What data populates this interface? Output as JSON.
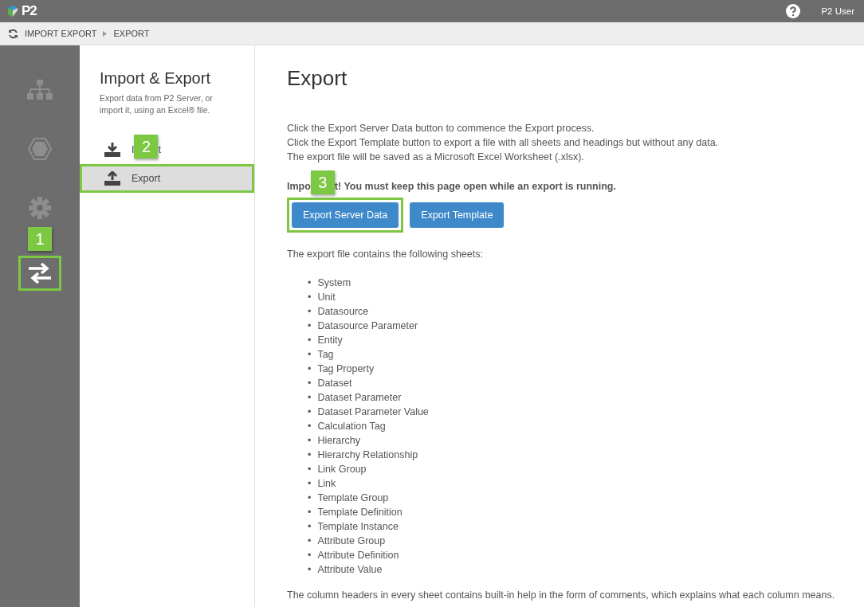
{
  "header": {
    "logo": "P2",
    "user": "P2 User"
  },
  "breadcrumb": [
    "IMPORT EXPORT",
    "EXPORT"
  ],
  "rail": [
    {
      "kind": "hierarchy",
      "selected": false,
      "highlighted": false
    },
    {
      "kind": "hexagon",
      "selected": false,
      "highlighted": false
    },
    {
      "kind": "gear",
      "selected": false,
      "highlighted": false,
      "callout": "1"
    },
    {
      "kind": "transfer",
      "selected": true,
      "highlighted": true
    }
  ],
  "panel": {
    "title": "Import & Export",
    "description": "Export data from P2 Server, or import it, using an Excel® file.",
    "items": [
      {
        "kind": "import",
        "label_parts": [
          "I",
          "t"
        ],
        "callout": "2",
        "selected": false,
        "highlighted": false
      },
      {
        "kind": "export",
        "label_parts": [
          "Export"
        ],
        "selected": true,
        "highlighted": true
      }
    ]
  },
  "main": {
    "title": "Export",
    "intro": [
      "Click the Export Server Data button to commence the Export process.",
      "Click the Export Template button to export a file with all sheets and headings but without any data.",
      "The export file will be saved as a Microsoft Excel Worksheet (.xlsx)."
    ],
    "warning_parts": [
      "Impo",
      "t! You must keep this page open while an export is running."
    ],
    "warning_callout": "3",
    "buttons": [
      {
        "label": "Export Server Data",
        "highlighted": true
      },
      {
        "label": "Export Template",
        "highlighted": false
      }
    ],
    "sheets_intro": "The export file contains the following sheets:",
    "bullet": "•",
    "sheets": [
      "System",
      "Unit",
      "Datasource",
      "Datasource Parameter",
      "Entity",
      "Tag",
      "Tag Property",
      "Dataset",
      "Dataset Parameter",
      "Dataset Parameter Value",
      "Calculation Tag",
      "Hierarchy",
      "Hierarchy Relationship",
      "Link Group",
      "Link",
      "Template Group",
      "Template Definition",
      "Template Instance",
      "Attribute Group",
      "Attribute Definition",
      "Attribute Value"
    ],
    "footer_note": "The column headers in every sheet contains built-in help in the form of comments, which explains what each column means."
  }
}
